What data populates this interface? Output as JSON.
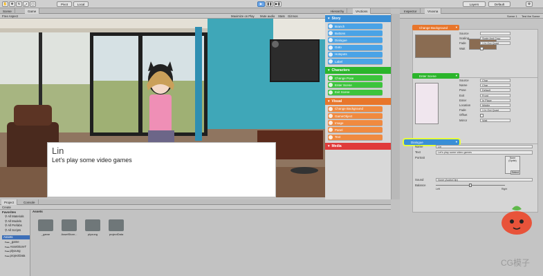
{
  "toolbar": {
    "pivot_label": "Pivot",
    "local_label": "Local",
    "layers_label": "Layers",
    "layout_label": "Default"
  },
  "scene_tabs": {
    "scene": "Scene",
    "game": "Game",
    "aspect": "Free Aspect"
  },
  "game_options": {
    "maximize": "Maximize on Play",
    "mute": "Mute audio",
    "stats": "Stats",
    "gizmos": "Gizmos"
  },
  "dialogue_preview": {
    "name": "Lin",
    "text": "Let's play some video games"
  },
  "vactions": {
    "tab_hierarchy": "Hierarchy",
    "tab_vactions": "VActions",
    "sections": [
      {
        "title": "Story",
        "color": "#3a8fd6",
        "item_color": "#4aa3e6",
        "items": [
          "Branch",
          "Buttons",
          "Dialogue",
          "Goto",
          "Hotspots",
          "Label"
        ]
      },
      {
        "title": "Characters",
        "color": "#2bb52b",
        "item_color": "#3cc43c",
        "items": [
          "Change Pose",
          "Enter Scene",
          "Exit Scene"
        ]
      },
      {
        "title": "Visual",
        "color": "#e8762b",
        "item_color": "#f08a40",
        "items": [
          "Change Background",
          "GameObject",
          "Image",
          "Panel",
          "Text"
        ]
      },
      {
        "title": "Media",
        "color": "#e03b3b",
        "item_color": "#e85050",
        "items": []
      }
    ]
  },
  "inspector": {
    "tab_inspector": "Inspector",
    "tab_vnovel": "Vnovna",
    "scene_label": "Scene 1",
    "test_label": "Test the Scene",
    "bg_node": {
      "title": "Change Background",
      "color": "#e8762b",
      "rows": [
        {
          "label": "Source",
          "value": ""
        },
        {
          "label": "Scaling",
          "value": "Scale And Crop"
        },
        {
          "label": "Fade",
          "value": "1   In Out Quad"
        },
        {
          "label": "Wait",
          "value": ""
        }
      ]
    },
    "enter_node": {
      "title": "Enter Scene",
      "color": "#2bb52b",
      "rows": [
        {
          "label": "Source",
          "value": "Char"
        },
        {
          "label": "Name",
          "value": "Char"
        },
        {
          "label": "Pose",
          "value": "Default"
        },
        {
          "label": "Exit",
          "value": "Front"
        },
        {
          "label": "Enter",
          "value": "In Place"
        },
        {
          "label": "Location",
          "value": "Middle"
        },
        {
          "label": "Fade",
          "value": "1   In Out Quad"
        },
        {
          "label": "Offset",
          "value": ""
        },
        {
          "label": "Mirror",
          "value": "Wait"
        }
      ]
    },
    "dialogue_node": {
      "title": "Dialogue",
      "color": "#3a8fd6",
      "rows": [
        {
          "label": "Name",
          "value": "Lin"
        },
        {
          "label": "Text",
          "value": "Let's play some video games"
        },
        {
          "label": "Portrait",
          "value": "None (Sprite)"
        },
        {
          "label": "Sound",
          "value": "None (AudioClip)"
        },
        {
          "label": "Balance",
          "value": ""
        }
      ],
      "select_label": "Select",
      "balance_left": "Left",
      "balance_right": "Right"
    }
  },
  "project": {
    "tab_project": "Project",
    "tab_console": "Console",
    "create_label": "Create",
    "favorites_label": "Favorites",
    "favorites": [
      "All Materials",
      "All Models",
      "All Prefabs",
      "All Scripts"
    ],
    "assets_label": "Assets",
    "tree": [
      "_game",
      "AssetStoreT",
      "plyoung",
      "projectData"
    ],
    "folders": [
      "_game",
      "AssetStore...",
      "plyoung",
      "projectData"
    ],
    "breadcrumb": "Assets"
  },
  "watermark": "CG模子"
}
